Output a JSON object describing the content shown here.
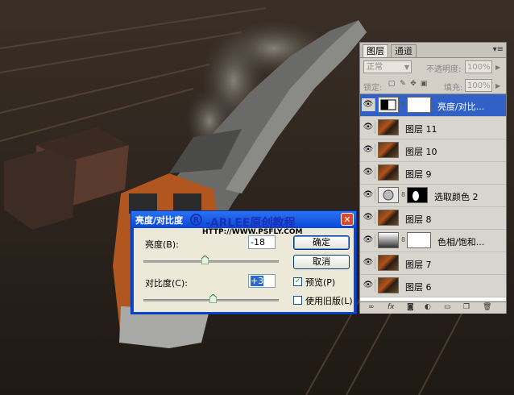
{
  "layers_panel": {
    "tabs": [
      "图层",
      "通道"
    ],
    "menu_icon": "panel-menu-icon",
    "blend_mode": "正常",
    "opacity_label": "不透明度:",
    "opacity_value": "100%",
    "lock_label": "锁定:",
    "fill_label": "填充:",
    "fill_value": "100%",
    "layers": [
      {
        "name": "亮度/对比...",
        "type": "adjustment",
        "selected": true
      },
      {
        "name": "图层 11",
        "type": "photo"
      },
      {
        "name": "图层 10",
        "type": "photo"
      },
      {
        "name": "图层 9",
        "type": "photo"
      },
      {
        "name": "选取颜色 2",
        "type": "adjustment"
      },
      {
        "name": "图层 8",
        "type": "photo"
      },
      {
        "name": "色相/饱和...",
        "type": "adjustment"
      },
      {
        "name": "图层 7",
        "type": "photo"
      },
      {
        "name": "图层 6",
        "type": "photo"
      }
    ],
    "footer_icons": [
      "link-icon",
      "fx-icon",
      "mask-icon",
      "adjustment-icon",
      "group-icon",
      "new-layer-icon",
      "trash-icon"
    ]
  },
  "dialog": {
    "title": "亮度/对比度",
    "close_label": "✕",
    "brightness_label": "亮度(B):",
    "brightness_value": "-18",
    "brightness_slider": 0.45,
    "contrast_label": "对比度(C):",
    "contrast_value": "+3",
    "contrast_slider": 0.51,
    "ok_label": "确定",
    "cancel_label": "取消",
    "preview_label": "预览(P)",
    "preview_checked": true,
    "legacy_label": "使用旧版(L)",
    "legacy_checked": false
  },
  "watermark": {
    "title": "-ARLEE原创教程",
    "reg": "R",
    "url": "HTTP://WWW.PSFLY.COM"
  },
  "colors": {
    "selected_layer": "#3161c6",
    "dialog_frame": "#0a46d8",
    "watermark": "#1a2fb5"
  }
}
